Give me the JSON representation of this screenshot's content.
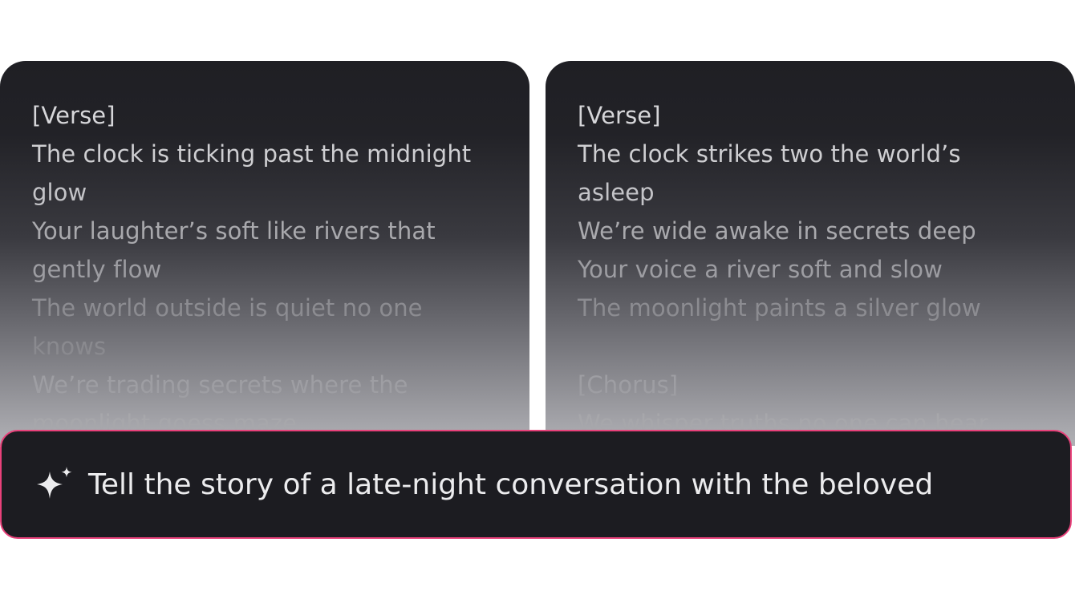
{
  "cards": [
    {
      "lines": [
        {
          "text": "[Verse]",
          "color": "#d6d6d9"
        },
        {
          "text": "The clock is ticking past the midnight",
          "color": "#cfcfd2"
        },
        {
          "text": "glow",
          "color": "#c4c4c8"
        },
        {
          "text": "Your laughter’s soft like rivers that",
          "color": "#a9a9ad"
        },
        {
          "text": "gently flow",
          "color": "#9d9da2"
        },
        {
          "text": "The world outside is quiet no one",
          "color": "#8c8c91"
        },
        {
          "text": "knows",
          "color": "#8a8a8f"
        },
        {
          "text": "We’re trading secrets where the",
          "color": "#9e9ea3"
        },
        {
          "text": "moonlight goess maze",
          "color": "#a7a7ab"
        }
      ]
    },
    {
      "lines": [
        {
          "text": "[Verse]",
          "color": "#d6d6d9"
        },
        {
          "text": "The clock strikes two the world’s",
          "color": "#cfcfd2"
        },
        {
          "text": "asleep",
          "color": "#c4c4c8"
        },
        {
          "text": "We’re wide awake in secrets deep",
          "color": "#a9a9ad"
        },
        {
          "text": "Your voice a river soft and slow",
          "color": "#9d9da2"
        },
        {
          "text": "The moonlight paints a silver glow",
          "color": "#8c8c91"
        },
        {
          "text": "",
          "color": "#8a8a8f"
        },
        {
          "text": "[Chorus]",
          "color": "#9e9ea3"
        },
        {
          "text": "We whisper truths no one can hear",
          "color": "#a7a7ab"
        }
      ]
    }
  ],
  "prompt": {
    "icon": "sparkle-icon",
    "text": "Tell the story of a late-night conversation with the beloved",
    "border_color": "#e8417a"
  }
}
